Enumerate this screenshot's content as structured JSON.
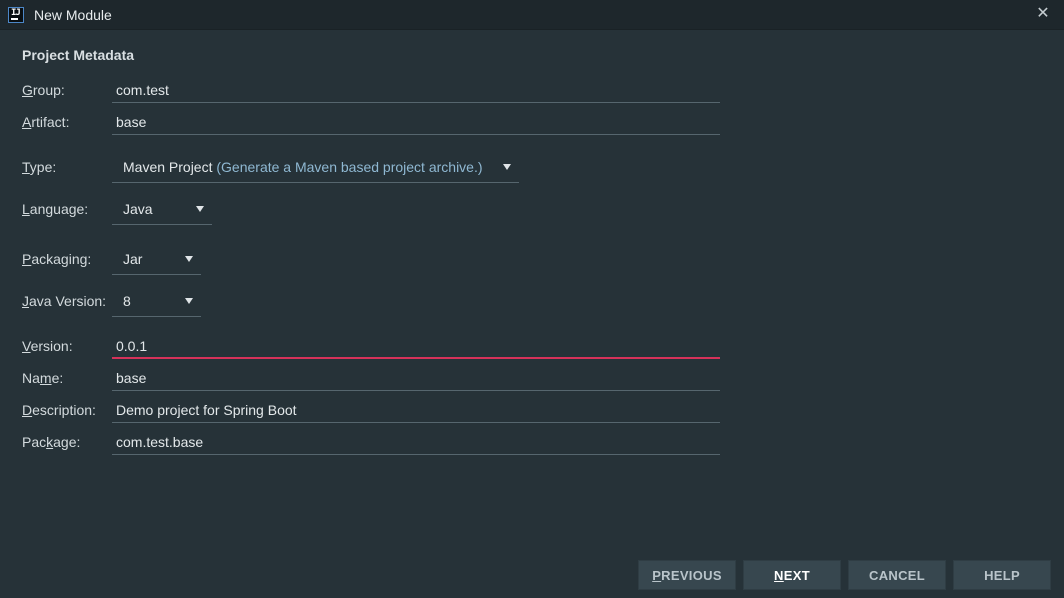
{
  "window": {
    "title": "New Module",
    "close_symbol": "✕"
  },
  "section": {
    "title": "Project Metadata"
  },
  "form": {
    "group": {
      "label_first": "G",
      "label_rest": "roup:",
      "value": "com.test"
    },
    "artifact": {
      "label_first": "A",
      "label_rest": "rtifact:",
      "value": "base"
    },
    "type": {
      "label_first": "T",
      "label_rest": "ype:",
      "value_main": "Maven Project",
      "value_hint": " (Generate a Maven based project archive.)"
    },
    "language": {
      "label_first": "L",
      "label_rest": "anguage:",
      "value": "Java"
    },
    "packaging": {
      "label_first": "P",
      "label_rest": "ackaging:",
      "value": "Jar"
    },
    "java_version": {
      "label_first": "J",
      "label_rest": "ava Version:",
      "value": "8"
    },
    "version": {
      "label_first": "V",
      "label_rest": "ersion:",
      "value": "0.0.1",
      "state": "error"
    },
    "name": {
      "label_pre": "Na",
      "label_first": "m",
      "label_rest": "e:",
      "value": "base"
    },
    "description": {
      "label_first": "D",
      "label_rest": "escription:",
      "value": "Demo project for Spring Boot"
    },
    "package": {
      "label_pre": "Pac",
      "label_first": "k",
      "label_rest": "age:",
      "value": "com.test.base"
    }
  },
  "buttons": {
    "previous": {
      "first": "P",
      "rest": "REVIOUS"
    },
    "next": {
      "first": "N",
      "rest": "EXT"
    },
    "cancel": {
      "label": "CANCEL"
    },
    "help": {
      "label": "HELP"
    }
  },
  "icons": {
    "app": "intellij-idea-icon",
    "close": "close-icon",
    "dropdown": "chevron-down-icon"
  },
  "colors": {
    "background": "#263238",
    "titlebar": "#1e272c",
    "field_underline": "#56666e",
    "error_underline": "#d6325a",
    "hint_text": "#8fb8d2",
    "button_bg": "#37474f"
  }
}
